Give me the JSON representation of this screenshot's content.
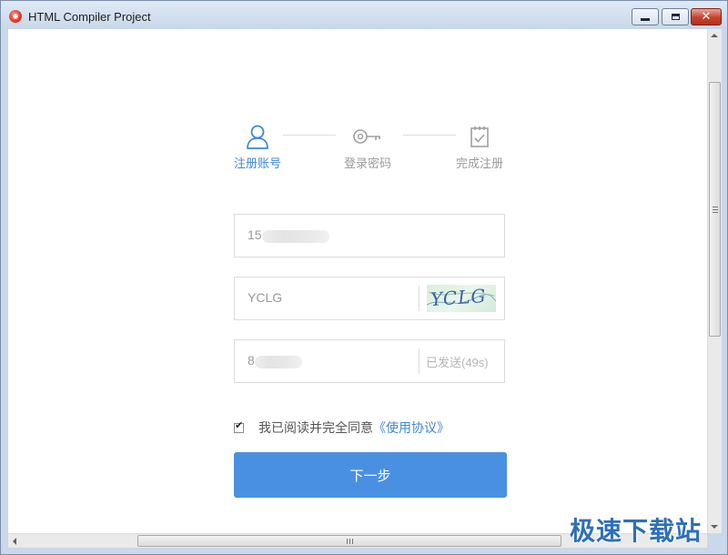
{
  "window": {
    "title": "HTML Compiler Project",
    "icon": "app-logo-icon"
  },
  "steps": [
    {
      "label": "注册账号",
      "icon": "user-icon",
      "active": true
    },
    {
      "label": "登录密码",
      "icon": "key-icon",
      "active": false
    },
    {
      "label": "完成注册",
      "icon": "clipboard-check-icon",
      "active": false
    }
  ],
  "form": {
    "phone": {
      "value": "15"
    },
    "captcha": {
      "value": "YCLG",
      "image_text": "YCLG"
    },
    "sms": {
      "value": "8",
      "button_label": "已发送(49s)"
    },
    "agreement": {
      "checked": true,
      "text": "我已阅读并完全同意",
      "link": "《使用协议》"
    },
    "next_label": "下一步"
  },
  "watermark": "极速下载站",
  "colors": {
    "accent": "#4a90e2",
    "active_step": "#3f87d9",
    "inactive_step": "#9a9a9a"
  }
}
